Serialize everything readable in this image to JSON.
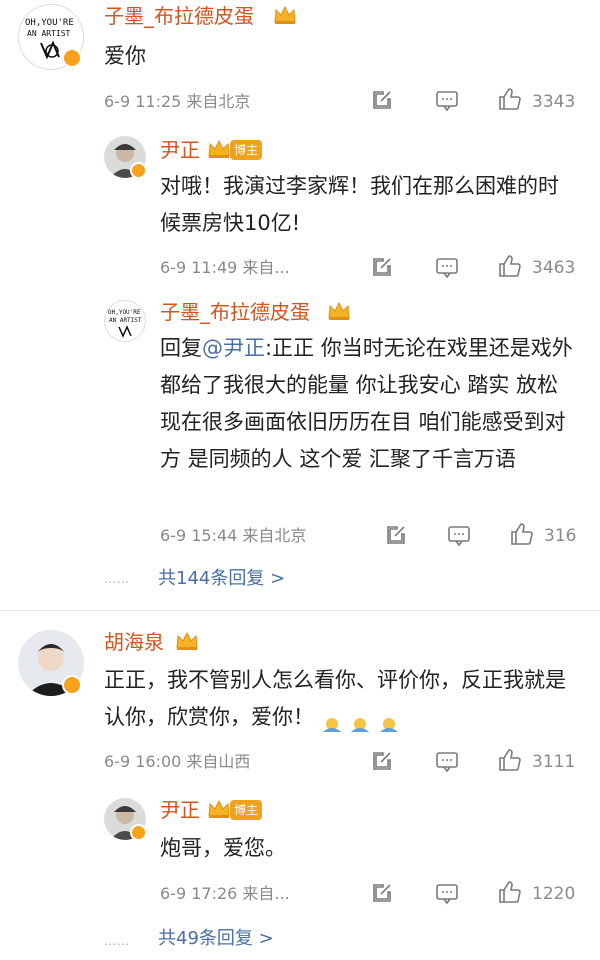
{
  "comments": [
    {
      "user": "子墨_布拉德皮蛋",
      "text": "爱你",
      "time": "6-9 11:25",
      "location": "来自北京",
      "likes": "3343",
      "avatar_text": "OH,YOU'RE AN ARTIST",
      "replies": [
        {
          "user": "尹正",
          "badge": "博主",
          "text": "对哦！我演过李家辉！我们在那么困难的时候票房快10亿!",
          "time": "6-9 11:49",
          "location": "来自...",
          "likes": "3463"
        },
        {
          "user": "子墨_布拉德皮蛋",
          "reply_prefix": "回复",
          "mention": "@尹正",
          "text": ":正正 你当时无论在戏里还是戏外都给了我很大的能量 你让我安心 踏实 放松 现在很多画面依旧历历在目 咱们能感受到对方 是同频的人 这个爱 汇聚了千言万语",
          "time": "6-9 15:44",
          "location": "来自北京",
          "likes": "316"
        }
      ],
      "more_replies": "共144条回复 >"
    },
    {
      "user": "胡海泉",
      "text": "正正，我不管别人怎么看你、评价你，反正我就是认你，欣赏你，爱你！",
      "emoji_count": 3,
      "time": "6-9 16:00",
      "location": "来自山西",
      "likes": "3111",
      "replies": [
        {
          "user": "尹正",
          "badge": "博主",
          "text": "炮哥，爱您。",
          "time": "6-9 17:26",
          "location": "来自...",
          "likes": "1220"
        }
      ],
      "more_replies": "共49条回复 >"
    }
  ],
  "dots": "……",
  "colors": {
    "username": "#d2541e",
    "link": "#4a6fa5",
    "meta": "#8a8a8a",
    "badge": "#f1a21c"
  },
  "icons": [
    "share-icon",
    "comment-icon",
    "like-icon",
    "crown-icon",
    "verified-icon"
  ]
}
